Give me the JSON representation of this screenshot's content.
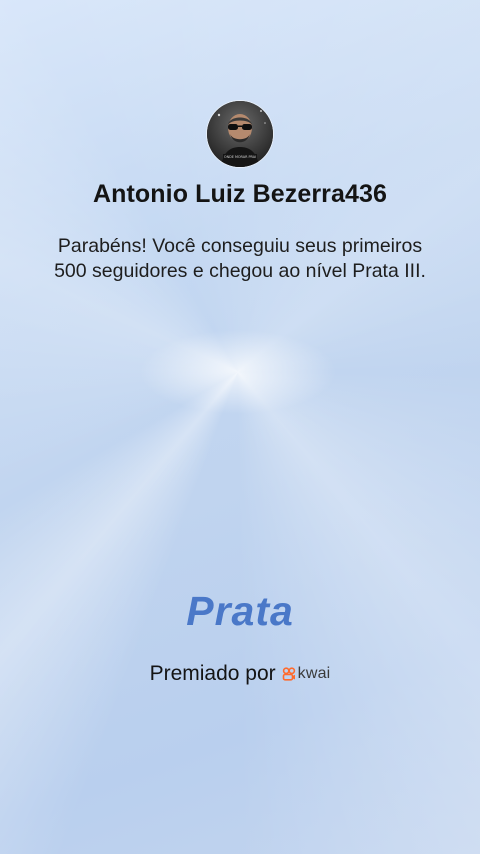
{
  "profile": {
    "name": "Antonio Luiz Bezerra436",
    "avatar_caption": "ONDE MORAR PRAI"
  },
  "message": "Parabéns! Você conseguiu seus primeiros 500 seguidores e chegou ao nível Prata III.",
  "level": {
    "title": "Prata"
  },
  "footer": {
    "awarded_by": "Premiado por",
    "brand_name": "kwai",
    "brand_icon": "kwai-logo-icon"
  },
  "colors": {
    "level_title": "#4a78c8",
    "brand_accent": "#ff6a2c"
  }
}
